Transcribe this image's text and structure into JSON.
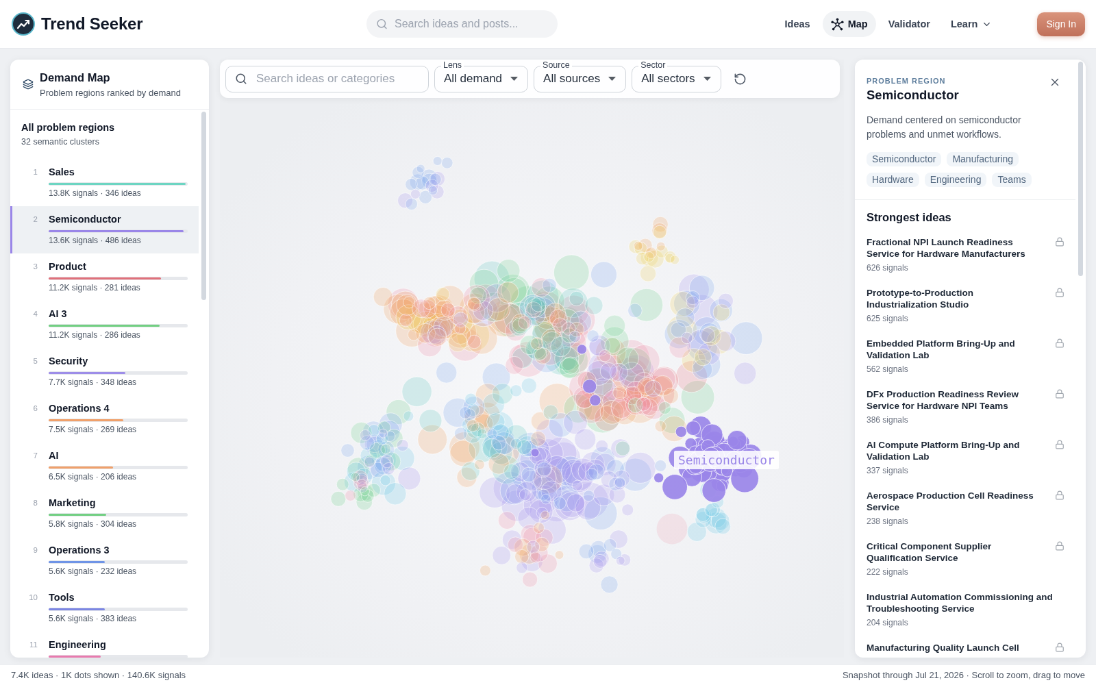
{
  "app": {
    "name": "Trend Seeker"
  },
  "header": {
    "search": {
      "placeholder": "Search ideas and posts..."
    },
    "nav": [
      {
        "label": "Ideas",
        "kind": "link",
        "selected": false
      },
      {
        "label": "Map",
        "kind": "icon-link",
        "selected": true
      },
      {
        "label": "Validator",
        "kind": "link",
        "selected": false
      },
      {
        "label": "Learn",
        "kind": "menu",
        "selected": false
      }
    ],
    "sign_in": "Sign In"
  },
  "sidebar": {
    "title": "Demand Map",
    "subtitle": "Problem regions ranked by demand",
    "all": {
      "title": "All problem regions",
      "subtitle": "32 semantic clusters"
    },
    "items": [
      {
        "rank": "1",
        "name": "Sales",
        "level": 1.0,
        "color": "#6dd5c2",
        "meta": "13.8K signals · 346 ideas",
        "selected": false
      },
      {
        "rank": "2",
        "name": "Semiconductor",
        "level": 0.985,
        "color": "#9a86e8",
        "meta": "13.6K signals · 486 ideas",
        "selected": true
      },
      {
        "rank": "3",
        "name": "Product",
        "level": 0.82,
        "color": "#e0707a",
        "meta": "11.2K signals · 281 ideas",
        "selected": false
      },
      {
        "rank": "4",
        "name": "AI 3",
        "level": 0.81,
        "color": "#72cf82",
        "meta": "11.2K signals · 286 ideas",
        "selected": false
      },
      {
        "rank": "5",
        "name": "Security",
        "level": 0.56,
        "color": "#9d8de8",
        "meta": "7.7K signals · 348 ideas",
        "selected": false
      },
      {
        "rank": "6",
        "name": "Operations 4",
        "level": 0.545,
        "color": "#f0a06a",
        "meta": "7.5K signals · 269 ideas",
        "selected": false
      },
      {
        "rank": "7",
        "name": "AI",
        "level": 0.47,
        "color": "#f0a06a",
        "meta": "6.5K signals · 206 ideas",
        "selected": false
      },
      {
        "rank": "8",
        "name": "Marketing",
        "level": 0.42,
        "color": "#72cf82",
        "meta": "5.8K signals · 304 ideas",
        "selected": false
      },
      {
        "rank": "9",
        "name": "Operations 3",
        "level": 0.41,
        "color": "#6f94e6",
        "meta": "5.6K signals · 232 ideas",
        "selected": false
      },
      {
        "rank": "10",
        "name": "Tools",
        "level": 0.41,
        "color": "#7c86e2",
        "meta": "5.6K signals · 383 ideas",
        "selected": false
      },
      {
        "rank": "11",
        "name": "Engineering",
        "level": 0.38,
        "color": "#e87aae",
        "selected": false
      }
    ]
  },
  "filters": {
    "search": {
      "placeholder": "Search ideas or categories"
    },
    "dropdowns": [
      {
        "label": "Lens",
        "value": "All demand"
      },
      {
        "label": "Source",
        "value": "All sources"
      },
      {
        "label": "Sector",
        "value": "All sectors"
      }
    ]
  },
  "map": {
    "highlight_label": "Semiconductor"
  },
  "detail": {
    "eyebrow": "PROBLEM REGION",
    "title": "Semiconductor",
    "description": "Demand centered on semiconductor problems and unmet workflows.",
    "tags": [
      "Semiconductor",
      "Manufacturing",
      "Hardware",
      "Engineering",
      "Teams"
    ],
    "ideas_title": "Strongest ideas",
    "ideas": [
      {
        "title": "Fractional NPI Launch Readiness Service for Hardware Manufacturers",
        "signals": "626 signals",
        "locked": true
      },
      {
        "title": "Prototype-to-Production Industrialization Studio",
        "signals": "625 signals",
        "locked": true
      },
      {
        "title": "Embedded Platform Bring-Up and Validation Lab",
        "signals": "562 signals",
        "locked": true
      },
      {
        "title": "DFx Production Readiness Review Service for Hardware NPI Teams",
        "signals": "386 signals",
        "locked": true
      },
      {
        "title": "AI Compute Platform Bring-Up and Validation Lab",
        "signals": "337 signals",
        "locked": true
      },
      {
        "title": "Aerospace Production Cell Readiness Service",
        "signals": "238 signals",
        "locked": true
      },
      {
        "title": "Critical Component Supplier Qualification Service",
        "signals": "222 signals",
        "locked": true
      },
      {
        "title": "Industrial Automation Commissioning and Troubleshooting Service",
        "signals": "204 signals",
        "locked": false
      },
      {
        "title": "Manufacturing Quality Launch Cell",
        "locked": true
      }
    ]
  },
  "status_bar": {
    "left": "7.4K ideas · 1K dots shown · 140.6K signals",
    "right": "Snapshot through Jul 21, 2026 · Scroll to zoom, drag to move"
  }
}
